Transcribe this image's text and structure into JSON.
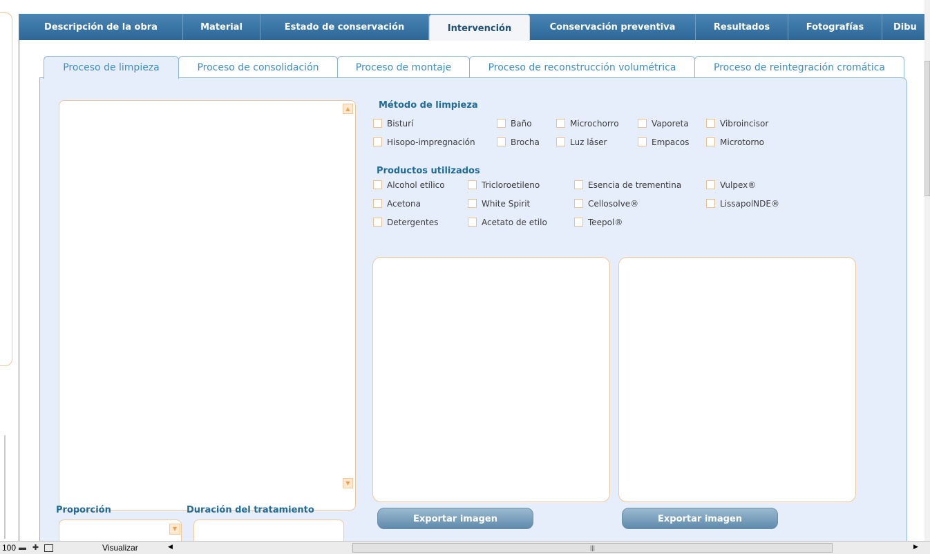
{
  "main_tabs": [
    {
      "label": "Descripción de la obra"
    },
    {
      "label": "Material"
    },
    {
      "label": "Estado de conservación"
    },
    {
      "label": "Intervención"
    },
    {
      "label": "Conservación preventiva"
    },
    {
      "label": "Resultados"
    },
    {
      "label": "Fotografías"
    },
    {
      "label": "Dibu"
    }
  ],
  "active_main_tab": "Intervención",
  "sub_tabs": [
    {
      "label": "Proceso de limpieza"
    },
    {
      "label": "Proceso de consolidación"
    },
    {
      "label": "Proceso de montaje"
    },
    {
      "label": "Proceso de reconstrucción volumétrica"
    },
    {
      "label": "Proceso de reintegración cromática"
    }
  ],
  "active_sub_tab": "Proceso de limpieza",
  "metodo": {
    "title": "Método de limpieza",
    "options": [
      "Bisturí",
      "Baño",
      "Microchorro",
      "Vaporeta",
      "Vibroincisor",
      "Hisopo-impregnación",
      "Brocha",
      "Luz láser",
      "Empacos",
      "Microtorno"
    ]
  },
  "productos": {
    "title": "Productos utilizados",
    "options": [
      "Alcohol etílico",
      "Tricloroetileno",
      "Esencia de trementina",
      "Vulpex®",
      "Acetona",
      "White Spirit",
      "Cellosolve®",
      "LissapolNDE®",
      "Detergentes",
      "Acetato de etilo",
      "Teepol®"
    ]
  },
  "buttons": {
    "export1": "Exportar imagen",
    "export2": "Exportar imagen"
  },
  "fields": {
    "proporcion_label": "Proporción",
    "duracion_label": "Duración del tratamiento"
  },
  "statusbar": {
    "zoom": "100",
    "mode": "Visualizar"
  },
  "colors": {
    "tab_blue": "#2c6797",
    "panel_bg": "#e6eefc",
    "field_border": "#f3c79a",
    "heading": "#1f6b9a"
  }
}
